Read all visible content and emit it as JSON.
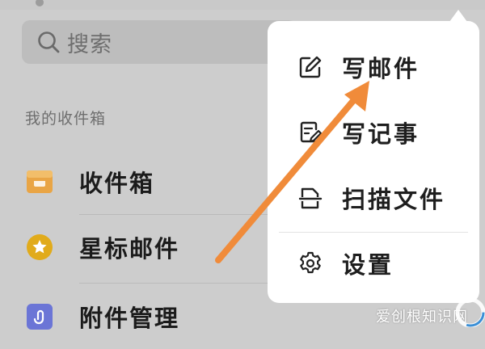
{
  "search": {
    "placeholder": "搜索"
  },
  "sidebar": {
    "section_title": "我的收件箱",
    "items": [
      {
        "label": "收件箱",
        "icon": "inbox-tray-icon",
        "color": "#E9A545"
      },
      {
        "label": "星标邮件",
        "icon": "star-icon",
        "color": "#E1AB1B"
      },
      {
        "label": "附件管理",
        "icon": "paperclip-icon",
        "color": "#6B75D6"
      }
    ]
  },
  "popup_menu": {
    "items": [
      {
        "label": "写邮件",
        "icon": "compose-pencil-icon"
      },
      {
        "label": "写记事",
        "icon": "note-pencil-icon"
      },
      {
        "label": "扫描文件",
        "icon": "scan-document-icon"
      },
      {
        "label": "设置",
        "icon": "gear-icon"
      }
    ]
  },
  "annotation": {
    "arrow_color": "#F08B3A"
  },
  "watermark": {
    "text": "爱创根知识网"
  }
}
